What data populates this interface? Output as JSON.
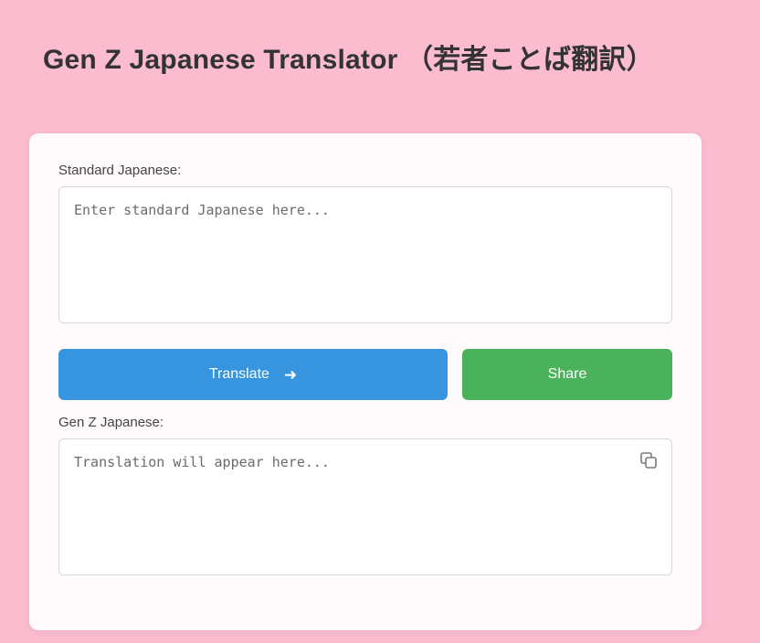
{
  "header": {
    "title": "Gen Z Japanese Translator （若者ことば翻訳）"
  },
  "input_section": {
    "label": "Standard Japanese:",
    "placeholder": "Enter standard Japanese here...",
    "value": ""
  },
  "actions": {
    "translate_label": "Translate",
    "translate_icon": "arrow-right-icon",
    "share_label": "Share"
  },
  "output_section": {
    "label": "Gen Z Japanese:",
    "placeholder": "Translation will appear here...",
    "value": "",
    "copy_icon": "copy-icon"
  },
  "colors": {
    "background": "#fbbccf",
    "translate_button": "#3794df",
    "share_button": "#4bb25c"
  }
}
